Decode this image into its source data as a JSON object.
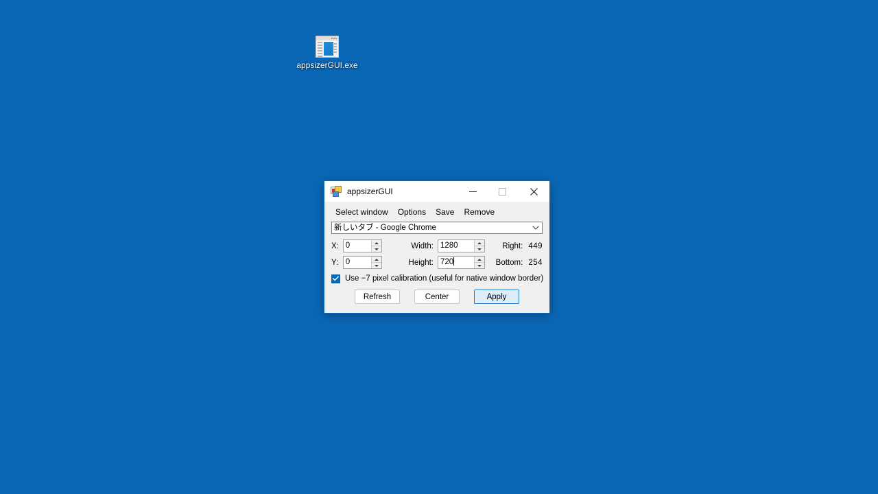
{
  "desktop": {
    "background_color": "#0a67b6",
    "icons": [
      {
        "name": "appsizerGUI.exe",
        "label": "appsizerGUI.exe",
        "icon": "window-app-icon"
      }
    ]
  },
  "window": {
    "title": "appsizerGUI",
    "icon": "appsizer-app-icon",
    "caption_buttons": {
      "minimize": "minimize-icon",
      "maximize": "maximize-icon",
      "close": "close-icon"
    },
    "menu": [
      {
        "label": "Select window"
      },
      {
        "label": "Options"
      },
      {
        "label": "Save"
      },
      {
        "label": "Remove"
      }
    ],
    "window_selector": {
      "value": "新しいタブ - Google Chrome",
      "arrow_icon": "chevron-down-icon"
    },
    "fields": {
      "x": {
        "label": "X:",
        "value": "0"
      },
      "y": {
        "label": "Y:",
        "value": "0"
      },
      "width": {
        "label": "Width:",
        "value": "1280"
      },
      "height": {
        "label": "Height:",
        "value": "720"
      },
      "right": {
        "label": "Right:",
        "value": "449"
      },
      "bottom": {
        "label": "Bottom:",
        "value": "254"
      }
    },
    "calibration": {
      "label": "Use −7 pixel calibration (useful for native window border)",
      "checked": true,
      "check_icon": "checkmark-icon",
      "accent_color": "#0a67b6"
    },
    "actions": {
      "refresh": "Refresh",
      "center": "Center",
      "apply": "Apply"
    }
  }
}
